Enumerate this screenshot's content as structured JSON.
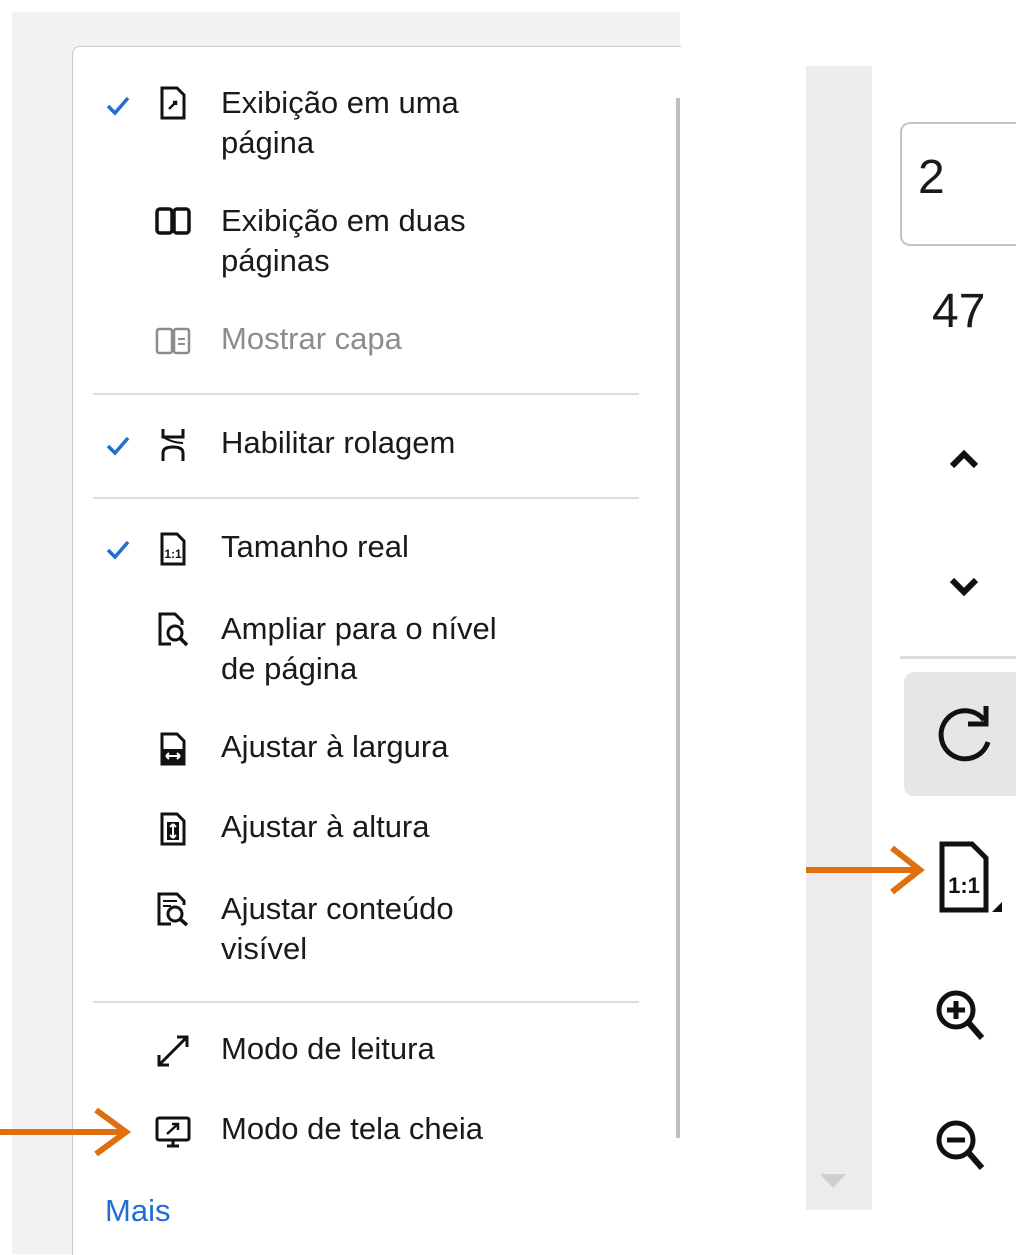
{
  "menu": {
    "items": [
      {
        "label": "Exibição em uma\npágina",
        "checked": true,
        "icon": "single-page-icon"
      },
      {
        "label": "Exibição em duas\npáginas",
        "checked": false,
        "icon": "two-page-icon"
      },
      {
        "label": "Mostrar capa",
        "checked": false,
        "disabled": true,
        "icon": "cover-page-icon"
      },
      {
        "label": "Habilitar rolagem",
        "checked": true,
        "icon": "scroll-icon"
      },
      {
        "label": "Tamanho real",
        "checked": true,
        "icon": "actual-size-icon"
      },
      {
        "label": "Ampliar para o nível\nde página",
        "checked": false,
        "icon": "zoom-page-icon"
      },
      {
        "label": "Ajustar à largura",
        "checked": false,
        "icon": "fit-width-icon"
      },
      {
        "label": "Ajustar à altura",
        "checked": false,
        "icon": "fit-height-icon"
      },
      {
        "label": "Ajustar conteúdo\nvisível",
        "checked": false,
        "icon": "fit-visible-icon"
      },
      {
        "label": "Modo de leitura",
        "checked": false,
        "icon": "reading-mode-icon"
      },
      {
        "label": "Modo de tela cheia",
        "checked": false,
        "icon": "fullscreen-icon"
      }
    ],
    "more_label": "Mais"
  },
  "toolbar": {
    "current_page": "2",
    "total_pages": "47",
    "icons": [
      "chevron-up-icon",
      "chevron-down-icon",
      "rotate-icon",
      "actual-size-icon",
      "zoom-in-icon",
      "zoom-out-icon"
    ]
  },
  "colors": {
    "check": "#1f6fd1",
    "arrow": "#e0700f",
    "link": "#1f6fd1"
  }
}
